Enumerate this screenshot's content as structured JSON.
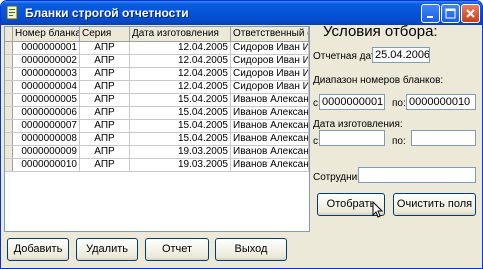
{
  "window": {
    "title": "Бланки строгой отчетности"
  },
  "table": {
    "columns": [
      "Номер бланка",
      "Серия",
      "Дата изготовления",
      "Ответственный сотр"
    ],
    "rows": [
      [
        "0000000001",
        "АПР",
        "12.04.2005",
        "Сидоров Иван Ив"
      ],
      [
        "0000000002",
        "АПР",
        "12.04.2005",
        "Сидоров Иван Ив"
      ],
      [
        "0000000003",
        "АПР",
        "12.04.2005",
        "Сидоров Иван Ив"
      ],
      [
        "0000000004",
        "АПР",
        "12.04.2005",
        "Сидоров Иван Ив"
      ],
      [
        "0000000005",
        "АПР",
        "15.04.2005",
        "Иванов Александ"
      ],
      [
        "0000000006",
        "АПР",
        "15.04.2005",
        "Иванов Александ"
      ],
      [
        "0000000007",
        "АПР",
        "15.04.2005",
        "Иванов Александ"
      ],
      [
        "0000000008",
        "АПР",
        "15.04.2005",
        "Иванов Александ"
      ],
      [
        "0000000009",
        "АПР",
        "19.03.2005",
        "Иванов Александ"
      ],
      [
        "0000000010",
        "АПР",
        "19.03.2005",
        "Иванов Александ"
      ]
    ]
  },
  "bottom_buttons": {
    "add": "Добавить",
    "delete": "Удалить",
    "report": "Отчет",
    "exit": "Выход"
  },
  "filter": {
    "heading": "Условия отбора:",
    "report_date_label": "Отчетная дата:",
    "report_date_value": "25.04.2006",
    "range_label": "Диапазон номеров бланков:",
    "from_label": "с:",
    "to_label": "по:",
    "range_from_value": "0000000001",
    "range_to_value": "0000000010",
    "manufacture_date_label": "Дата изготовления:",
    "date_from_label": "с:",
    "date_to_label": "по:",
    "date_from_value": "",
    "date_to_value": "",
    "employee_label": "Сотрудник:",
    "employee_value": "",
    "select_button": "Отобрать",
    "clear_button": "Очистить поля"
  }
}
